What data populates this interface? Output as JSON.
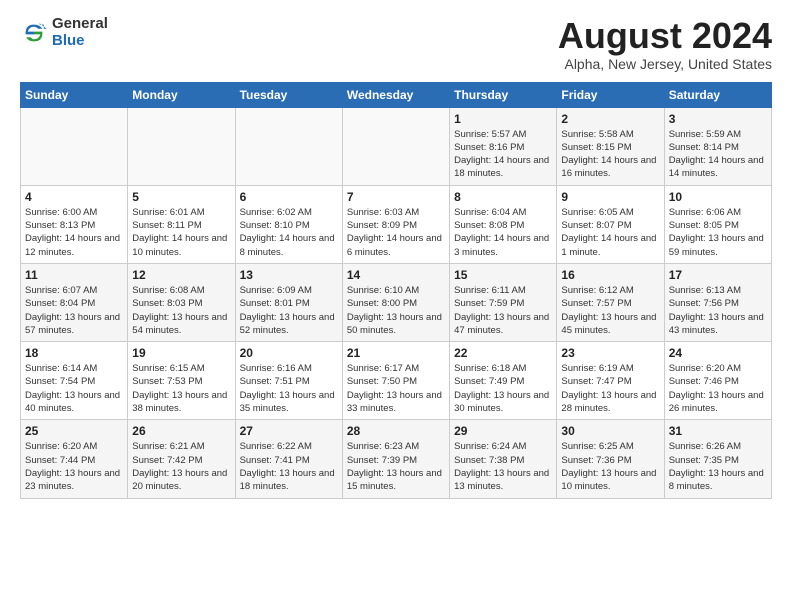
{
  "header": {
    "logo_general": "General",
    "logo_blue": "Blue",
    "month_title": "August 2024",
    "location": "Alpha, New Jersey, United States"
  },
  "days_of_week": [
    "Sunday",
    "Monday",
    "Tuesday",
    "Wednesday",
    "Thursday",
    "Friday",
    "Saturday"
  ],
  "weeks": [
    [
      {
        "day": "",
        "info": ""
      },
      {
        "day": "",
        "info": ""
      },
      {
        "day": "",
        "info": ""
      },
      {
        "day": "",
        "info": ""
      },
      {
        "day": "1",
        "info": "Sunrise: 5:57 AM\nSunset: 8:16 PM\nDaylight: 14 hours\nand 18 minutes."
      },
      {
        "day": "2",
        "info": "Sunrise: 5:58 AM\nSunset: 8:15 PM\nDaylight: 14 hours\nand 16 minutes."
      },
      {
        "day": "3",
        "info": "Sunrise: 5:59 AM\nSunset: 8:14 PM\nDaylight: 14 hours\nand 14 minutes."
      }
    ],
    [
      {
        "day": "4",
        "info": "Sunrise: 6:00 AM\nSunset: 8:13 PM\nDaylight: 14 hours\nand 12 minutes."
      },
      {
        "day": "5",
        "info": "Sunrise: 6:01 AM\nSunset: 8:11 PM\nDaylight: 14 hours\nand 10 minutes."
      },
      {
        "day": "6",
        "info": "Sunrise: 6:02 AM\nSunset: 8:10 PM\nDaylight: 14 hours\nand 8 minutes."
      },
      {
        "day": "7",
        "info": "Sunrise: 6:03 AM\nSunset: 8:09 PM\nDaylight: 14 hours\nand 6 minutes."
      },
      {
        "day": "8",
        "info": "Sunrise: 6:04 AM\nSunset: 8:08 PM\nDaylight: 14 hours\nand 3 minutes."
      },
      {
        "day": "9",
        "info": "Sunrise: 6:05 AM\nSunset: 8:07 PM\nDaylight: 14 hours\nand 1 minute."
      },
      {
        "day": "10",
        "info": "Sunrise: 6:06 AM\nSunset: 8:05 PM\nDaylight: 13 hours\nand 59 minutes."
      }
    ],
    [
      {
        "day": "11",
        "info": "Sunrise: 6:07 AM\nSunset: 8:04 PM\nDaylight: 13 hours\nand 57 minutes."
      },
      {
        "day": "12",
        "info": "Sunrise: 6:08 AM\nSunset: 8:03 PM\nDaylight: 13 hours\nand 54 minutes."
      },
      {
        "day": "13",
        "info": "Sunrise: 6:09 AM\nSunset: 8:01 PM\nDaylight: 13 hours\nand 52 minutes."
      },
      {
        "day": "14",
        "info": "Sunrise: 6:10 AM\nSunset: 8:00 PM\nDaylight: 13 hours\nand 50 minutes."
      },
      {
        "day": "15",
        "info": "Sunrise: 6:11 AM\nSunset: 7:59 PM\nDaylight: 13 hours\nand 47 minutes."
      },
      {
        "day": "16",
        "info": "Sunrise: 6:12 AM\nSunset: 7:57 PM\nDaylight: 13 hours\nand 45 minutes."
      },
      {
        "day": "17",
        "info": "Sunrise: 6:13 AM\nSunset: 7:56 PM\nDaylight: 13 hours\nand 43 minutes."
      }
    ],
    [
      {
        "day": "18",
        "info": "Sunrise: 6:14 AM\nSunset: 7:54 PM\nDaylight: 13 hours\nand 40 minutes."
      },
      {
        "day": "19",
        "info": "Sunrise: 6:15 AM\nSunset: 7:53 PM\nDaylight: 13 hours\nand 38 minutes."
      },
      {
        "day": "20",
        "info": "Sunrise: 6:16 AM\nSunset: 7:51 PM\nDaylight: 13 hours\nand 35 minutes."
      },
      {
        "day": "21",
        "info": "Sunrise: 6:17 AM\nSunset: 7:50 PM\nDaylight: 13 hours\nand 33 minutes."
      },
      {
        "day": "22",
        "info": "Sunrise: 6:18 AM\nSunset: 7:49 PM\nDaylight: 13 hours\nand 30 minutes."
      },
      {
        "day": "23",
        "info": "Sunrise: 6:19 AM\nSunset: 7:47 PM\nDaylight: 13 hours\nand 28 minutes."
      },
      {
        "day": "24",
        "info": "Sunrise: 6:20 AM\nSunset: 7:46 PM\nDaylight: 13 hours\nand 26 minutes."
      }
    ],
    [
      {
        "day": "25",
        "info": "Sunrise: 6:20 AM\nSunset: 7:44 PM\nDaylight: 13 hours\nand 23 minutes."
      },
      {
        "day": "26",
        "info": "Sunrise: 6:21 AM\nSunset: 7:42 PM\nDaylight: 13 hours\nand 20 minutes."
      },
      {
        "day": "27",
        "info": "Sunrise: 6:22 AM\nSunset: 7:41 PM\nDaylight: 13 hours\nand 18 minutes."
      },
      {
        "day": "28",
        "info": "Sunrise: 6:23 AM\nSunset: 7:39 PM\nDaylight: 13 hours\nand 15 minutes."
      },
      {
        "day": "29",
        "info": "Sunrise: 6:24 AM\nSunset: 7:38 PM\nDaylight: 13 hours\nand 13 minutes."
      },
      {
        "day": "30",
        "info": "Sunrise: 6:25 AM\nSunset: 7:36 PM\nDaylight: 13 hours\nand 10 minutes."
      },
      {
        "day": "31",
        "info": "Sunrise: 6:26 AM\nSunset: 7:35 PM\nDaylight: 13 hours\nand 8 minutes."
      }
    ]
  ]
}
